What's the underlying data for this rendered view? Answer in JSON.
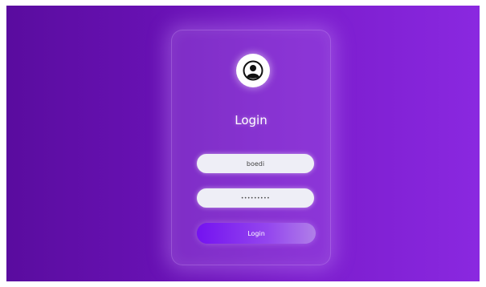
{
  "login_card": {
    "title": "Login",
    "username": {
      "value": "boedi"
    },
    "password": {
      "value": "•••••••••"
    },
    "submit_label": "Login"
  },
  "icons": {
    "avatar": "user-avatar-icon"
  },
  "colors": {
    "background_start": "#5a0c9f",
    "background_end": "#8a28e0",
    "button_start": "#7412f0",
    "button_end": "#b07fe8",
    "input_background": "#eeeef6"
  }
}
